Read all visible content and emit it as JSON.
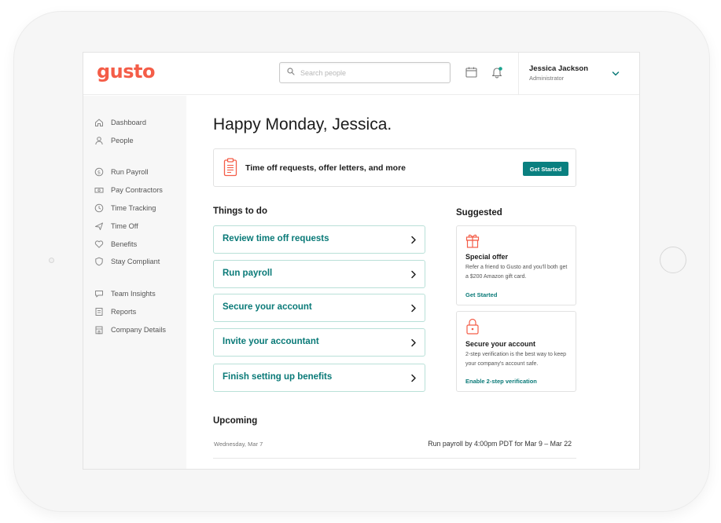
{
  "app": {
    "logo": "gusto"
  },
  "header": {
    "search_placeholder": "Search people",
    "user": {
      "name": "Jessica Jackson",
      "role": "Administrator"
    }
  },
  "sidebar": {
    "items": [
      {
        "label": "Dashboard",
        "icon": "home-icon"
      },
      {
        "label": "People",
        "icon": "person-icon"
      },
      {
        "label": "Run Payroll",
        "icon": "dollar-circle-icon"
      },
      {
        "label": "Pay Contractors",
        "icon": "cash-icon"
      },
      {
        "label": "Time Tracking",
        "icon": "clock-icon"
      },
      {
        "label": "Time Off",
        "icon": "plane-icon"
      },
      {
        "label": "Benefits",
        "icon": "heart-icon"
      },
      {
        "label": "Stay Compliant",
        "icon": "shield-icon"
      },
      {
        "label": "Team Insights",
        "icon": "chat-icon"
      },
      {
        "label": "Reports",
        "icon": "report-icon"
      },
      {
        "label": "Company Details",
        "icon": "building-icon"
      }
    ]
  },
  "main": {
    "greeting": "Happy Monday, Jessica.",
    "banner": {
      "text": "Time off requests, offer letters, and more",
      "button": "Get Started"
    },
    "todo": {
      "title": "Things to do",
      "items": [
        "Review time off requests",
        "Run payroll",
        "Secure your account",
        "Invite your accountant",
        "Finish setting up benefits"
      ]
    },
    "suggested": {
      "title": "Suggested",
      "cards": [
        {
          "title": "Special offer",
          "body": "Refer a friend to Gusto and you'll both get a $200 Amazon gift card.",
          "link": "Get Started",
          "icon": "gift-icon"
        },
        {
          "title": "Secure your account",
          "body": "2-step verification is the best way to keep your company's account safe.",
          "link": "Enable 2-step verification",
          "icon": "lock-icon"
        }
      ]
    },
    "upcoming": {
      "title": "Upcoming",
      "items": [
        {
          "date": "Wednesday, Mar 7",
          "description": "Run payroll by 4:00pm PDT for Mar 9 – Mar 22"
        }
      ]
    }
  },
  "colors": {
    "brand": "#f45d48",
    "accent": "#0a8080",
    "link": "#0a7a78",
    "todo_border": "#b9e0d8"
  }
}
